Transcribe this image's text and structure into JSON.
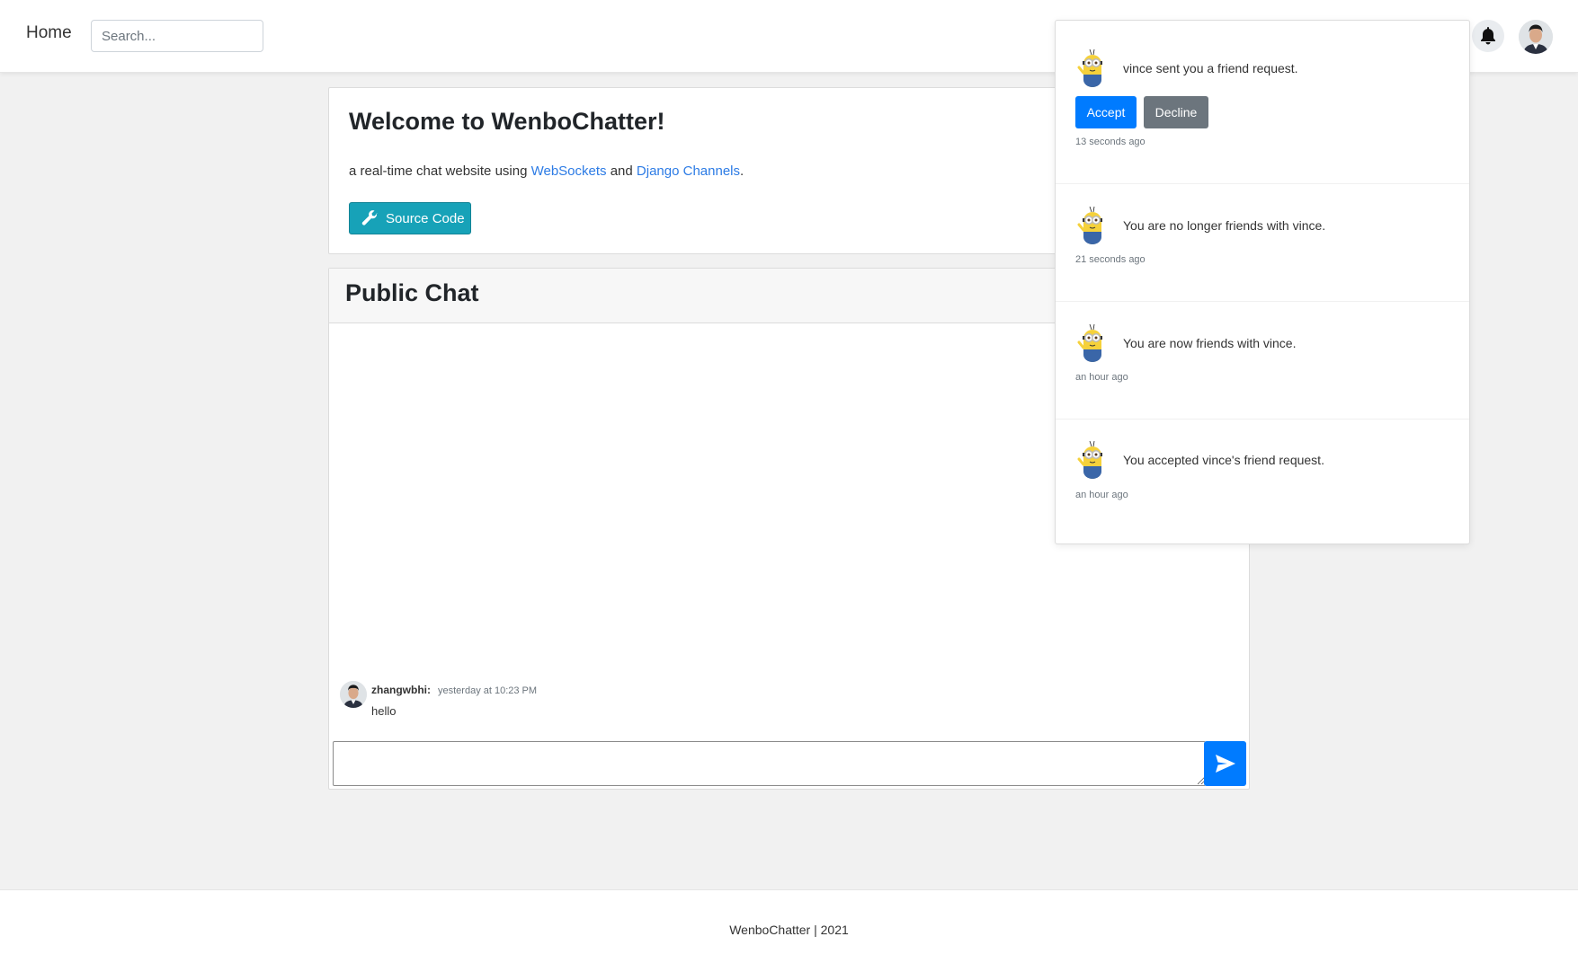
{
  "navbar": {
    "home_label": "Home",
    "search_placeholder": "Search..."
  },
  "welcome": {
    "title": "Welcome to WenboChatter!",
    "description_prefix": "a real-time chat website using ",
    "link_websockets": "WebSockets",
    "description_and": " and ",
    "link_django": "Django Channels",
    "description_suffix": ".",
    "source_button": "Source Code"
  },
  "chat": {
    "title": "Public Chat",
    "messages": [
      {
        "username": "zhangwbhi:",
        "timestamp": "yesterday at 10:23 PM",
        "text": "hello"
      }
    ]
  },
  "notifications": [
    {
      "text": "vince sent you a friend request.",
      "time": "13 seconds ago",
      "accept_label": "Accept",
      "decline_label": "Decline"
    },
    {
      "text": "You are no longer friends with vince.",
      "time": "21 seconds ago"
    },
    {
      "text": "You are now friends with vince.",
      "time": "an hour ago"
    },
    {
      "text": "You accepted vince's friend request.",
      "time": "an hour ago"
    }
  ],
  "footer": {
    "text": "WenboChatter | 2021"
  },
  "colors": {
    "primary": "#007bff",
    "info": "#17a2b8",
    "secondary": "#6c757d",
    "link": "#2c7be5",
    "background": "#f1f1f1"
  },
  "icons": {
    "bell": "bell-icon",
    "wrench": "wrench-icon",
    "send": "paper-plane-icon"
  }
}
